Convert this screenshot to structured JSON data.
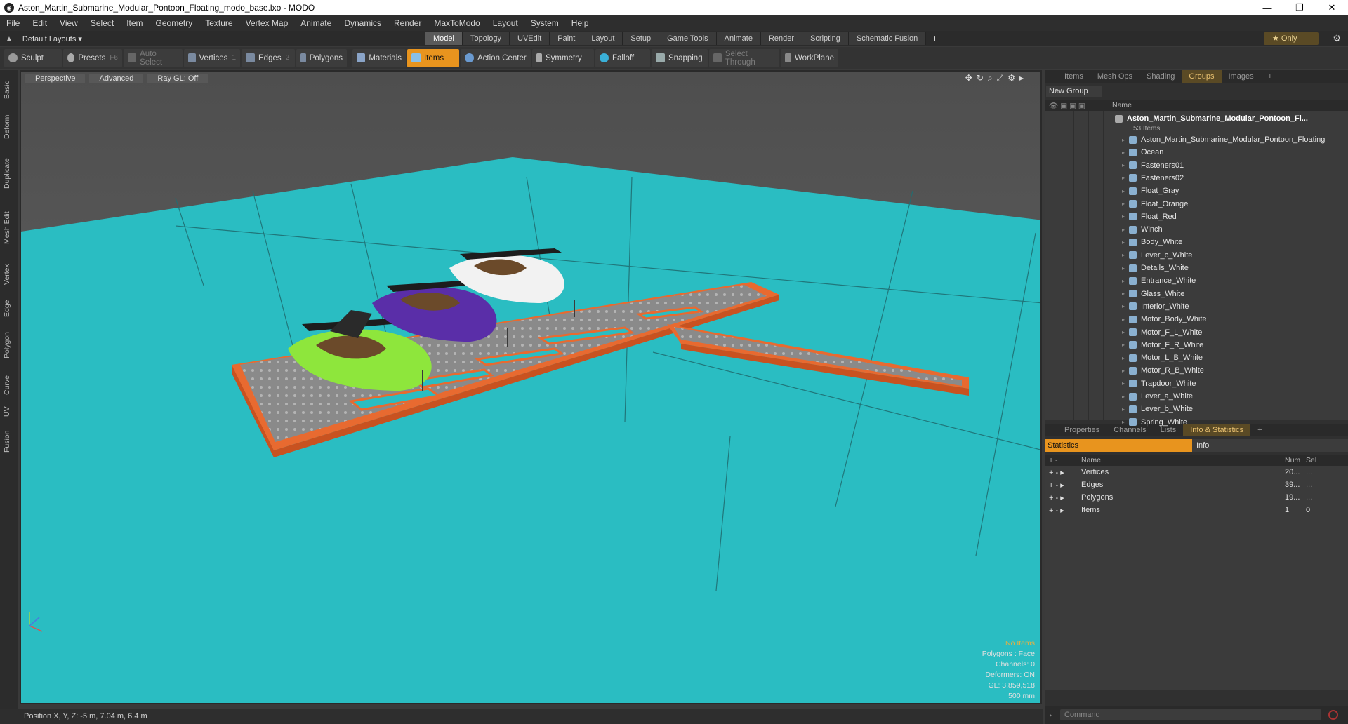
{
  "window": {
    "title": "Aston_Martin_Submarine_Modular_Pontoon_Floating_modo_base.lxo - MODO",
    "minimize": "—",
    "restore": "❐",
    "close": "✕"
  },
  "menu": [
    "File",
    "Edit",
    "View",
    "Select",
    "Item",
    "Geometry",
    "Texture",
    "Vertex Map",
    "Animate",
    "Dynamics",
    "Render",
    "MaxToModo",
    "Layout",
    "System",
    "Help"
  ],
  "layouts": {
    "label": "Default Layouts ▾"
  },
  "tabs": [
    "Model",
    "Topology",
    "UVEdit",
    "Paint",
    "Layout",
    "Setup",
    "Game Tools",
    "Animate",
    "Render",
    "Scripting",
    "Schematic Fusion"
  ],
  "tabs_plus": "+",
  "only_label": "★  Only",
  "toolbar": {
    "sculpt": "Sculpt",
    "presets": "Presets",
    "presets_key": "F6",
    "auto_select": "Auto Select",
    "vertices": "Vertices",
    "vertices_key": "1",
    "edges": "Edges",
    "edges_key": "2",
    "polygons": "Polygons",
    "materials": "Materials",
    "items": "Items",
    "action_center": "Action Center",
    "symmetry": "Symmetry",
    "falloff": "Falloff",
    "snapping": "Snapping",
    "select_through": "Select Through",
    "workplane": "WorkPlane"
  },
  "left_tabs": [
    "Basic",
    "Deform",
    "Duplicate",
    "Mesh Edit",
    "Vertex",
    "Edge",
    "Polygon",
    "Curve",
    "UV",
    "Fusion"
  ],
  "viewport": {
    "perspective": "Perspective",
    "advanced": "Advanced",
    "raygl": "Ray GL: Off",
    "overlay": [
      "No Items",
      "Polygons : Face",
      "Channels: 0",
      "Deformers: ON",
      "GL: 3,859,518",
      "500 mm"
    ],
    "sky_color": "#5e5e5e",
    "ocean_color": "#2abdc2",
    "pontoon_orange": "#e86a30",
    "pontoon_gray": "#8e8e8e",
    "sub_colors": {
      "green": "#8ee63c",
      "purple": "#5a2ea8",
      "white": "#f2f2f2"
    }
  },
  "items_panel": {
    "tabs": [
      "Items",
      "Mesh Ops",
      "Shading",
      "Groups",
      "Images"
    ],
    "active_tab": "Groups",
    "tabs_plus": "+",
    "new_group": "New Group",
    "col_name": "Name",
    "group_title": "Aston_Martin_Submarine_Modular_Pontoon_Fl...",
    "group_count": "53 Items",
    "items": [
      "Aston_Martin_Submarine_Modular_Pontoon_Floating",
      "Ocean",
      "Fasteners01",
      "Fasteners02",
      "Float_Gray",
      "Float_Orange",
      "Float_Red",
      "Winch",
      "Body_White",
      "Lever_c_White",
      "Details_White",
      "Entrance_White",
      "Glass_White",
      "Interior_White",
      "Motor_Body_White",
      "Motor_F_L_White",
      "Motor_F_R_White",
      "Motor_L_B_White",
      "Motor_R_B_White",
      "Trapdoor_White",
      "Lever_a_White",
      "Lever_b_White",
      "Spring_White"
    ]
  },
  "props_panel": {
    "tabs": [
      "Properties",
      "Channels",
      "Lists",
      "Info & Statistics"
    ],
    "active_tab": "Info & Statistics",
    "tabs_plus": "+",
    "statistics": "Statistics",
    "info": "Info",
    "cols": {
      "name": "Name",
      "num": "Num",
      "sel": "Sel"
    },
    "rows": [
      {
        "name": "Vertices",
        "num": "20...",
        "sel": "..."
      },
      {
        "name": "Edges",
        "num": "39...",
        "sel": "..."
      },
      {
        "name": "Polygons",
        "num": "19...",
        "sel": "..."
      },
      {
        "name": "Items",
        "num": "1",
        "sel": "0"
      }
    ]
  },
  "command": {
    "placeholder": "Command"
  },
  "status": {
    "position": "Position X, Y, Z:  -5 m, 7.04 m, 6.4 m"
  }
}
